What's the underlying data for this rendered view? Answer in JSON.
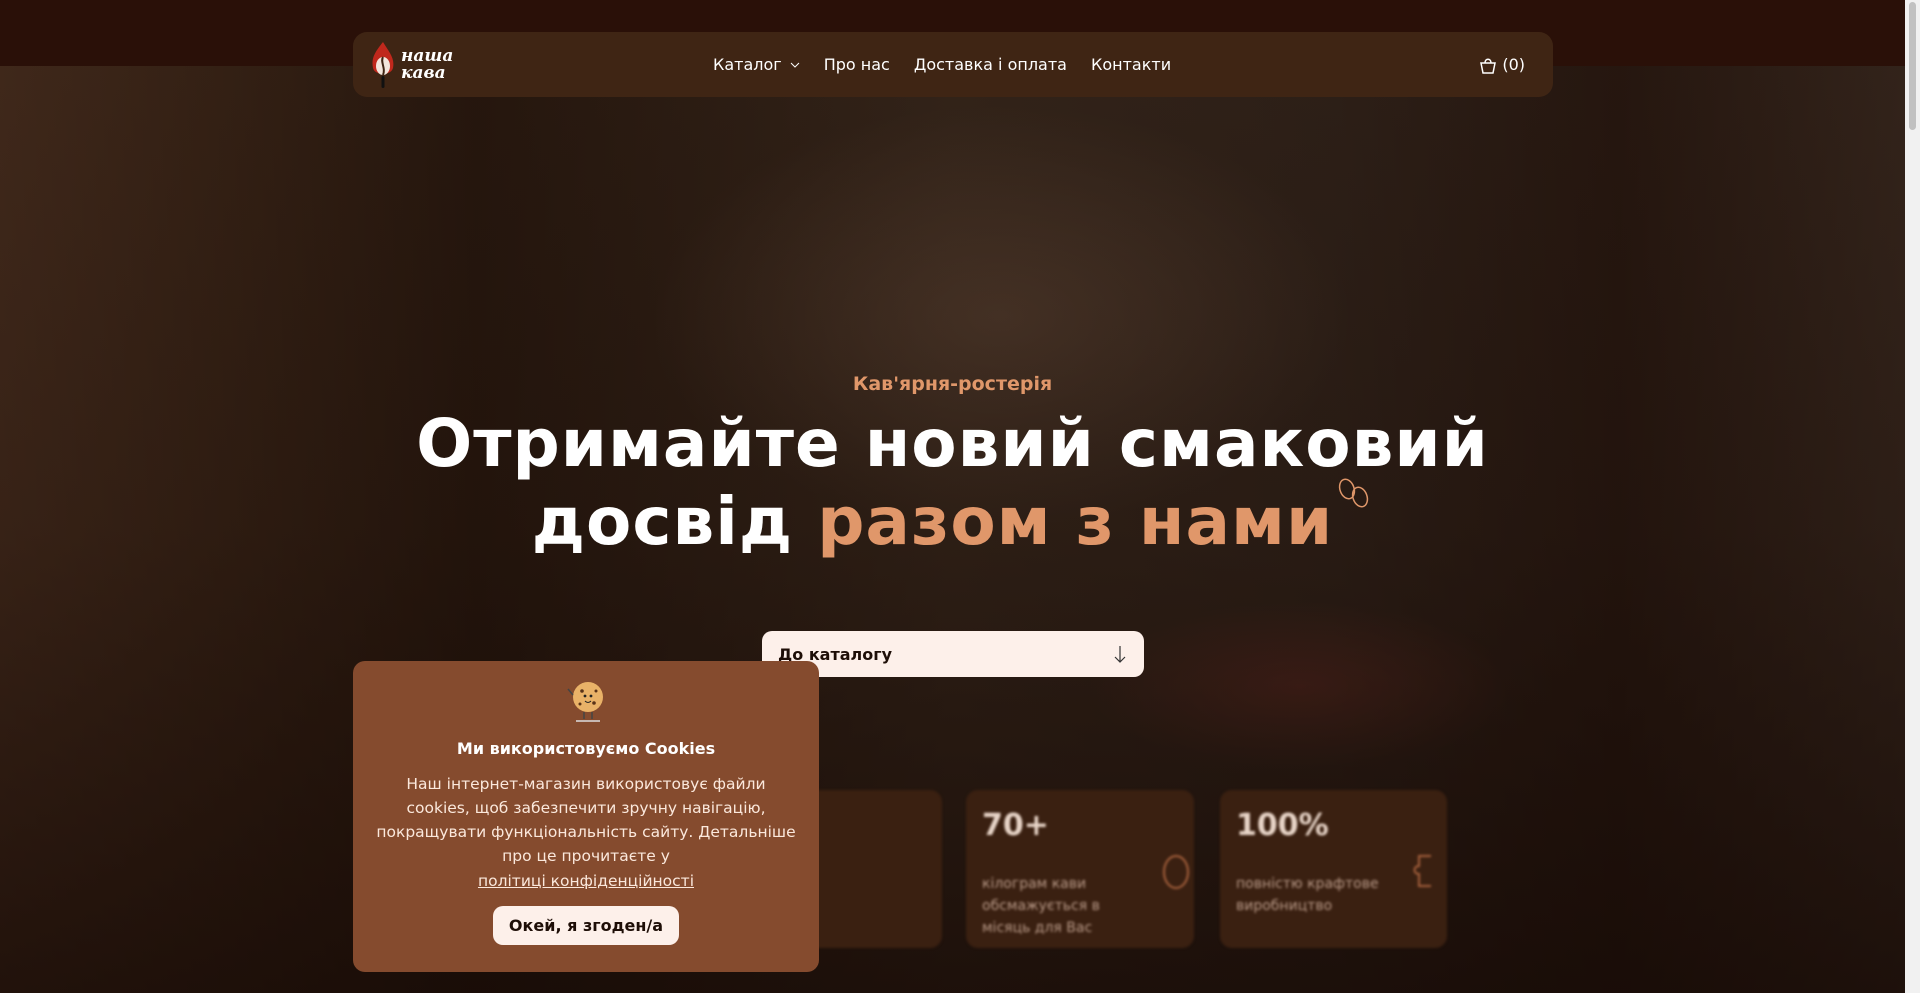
{
  "colors": {
    "accent": "#e0976a",
    "nav_bg": "#3f2514",
    "cookie_bg": "#854b2e",
    "button_bg": "#fdf0ea"
  },
  "logo": {
    "line1": "наша",
    "line2": "кава"
  },
  "nav": {
    "items": [
      {
        "label": "Каталог",
        "has_dropdown": true
      },
      {
        "label": "Про нас"
      },
      {
        "label": "Доставка і оплата"
      },
      {
        "label": "Контакти"
      }
    ],
    "cart": {
      "icon": "shopping-bag-icon",
      "count": "(0)"
    }
  },
  "hero": {
    "eyebrow": "Кав'ярня-ростерія",
    "title_line1": "Отримайте новий смаковий",
    "title_line2_plain": "досвід ",
    "title_line2_accent": "разом з нами",
    "cta_label": "До каталогу",
    "cta_icon": "arrow-down-icon"
  },
  "stats": [
    {
      "value": "",
      "desc": ""
    },
    {
      "value": "70+",
      "desc": "кілограм кави обсмажується в місяць для Вас",
      "icon": "coffee-bean-icon"
    },
    {
      "value": "100%",
      "desc": "повністю крафтове виробництво",
      "icon": "puzzle-icon"
    }
  ],
  "cookie": {
    "icon": "cookie-mascot-icon",
    "title": "Ми використовуємо Cookies",
    "text": "Наш інтернет-магазин використовує файли cookies, щоб забезпечити зручну навігацію, покращувати функціональність сайту. Детальніше про це прочитаєте у",
    "link": "політиці конфіденційності",
    "accept": "Окей, я згоден/а"
  }
}
